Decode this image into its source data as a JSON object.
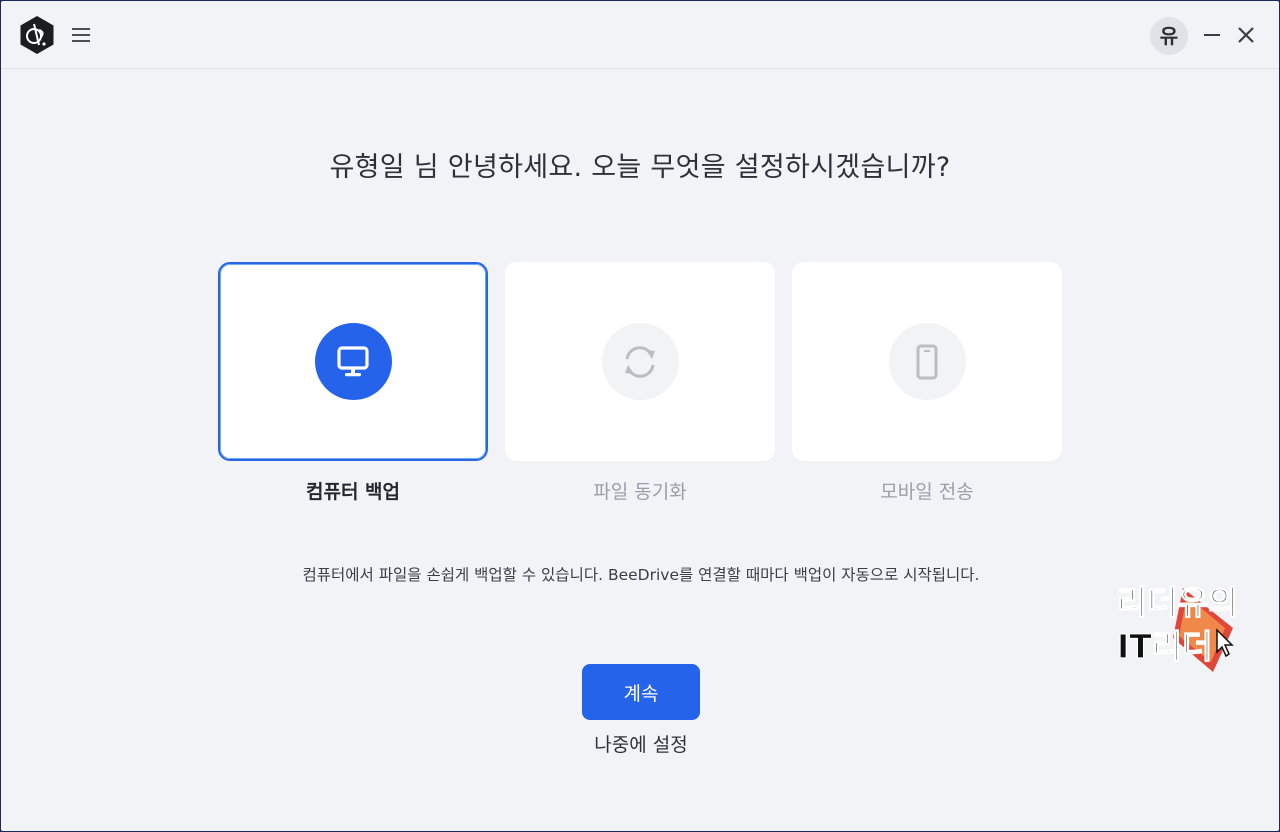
{
  "titlebar": {
    "avatar_text": "유",
    "icons": [
      "beedrive-logo-icon",
      "hamburger-menu-icon",
      "minimize-icon",
      "close-icon"
    ]
  },
  "main": {
    "heading": "유형일 님 안녕하세요. 오늘 무엇을 설정하시겠습니까?",
    "options": [
      {
        "label": "컴퓨터 백업",
        "icon": "monitor-icon",
        "selected": true
      },
      {
        "label": "파일 동기화",
        "icon": "sync-icon",
        "selected": false
      },
      {
        "label": "모바일 전송",
        "icon": "smartphone-icon",
        "selected": false
      }
    ],
    "description": "컴퓨터에서 파일을 손쉽게 백업할 수 있습니다. BeeDrive를 연결할 때마다 백업이 자동으로 시작됩니다.",
    "continue_label": "계속",
    "later_label": "나중에 설정"
  },
  "watermark": {
    "line1": "리더유의",
    "line2": "IT리더"
  },
  "colors": {
    "accent": "#2563eb",
    "background": "#f1f3f6",
    "card": "#ffffff",
    "muted_text": "#9aa0a8"
  }
}
